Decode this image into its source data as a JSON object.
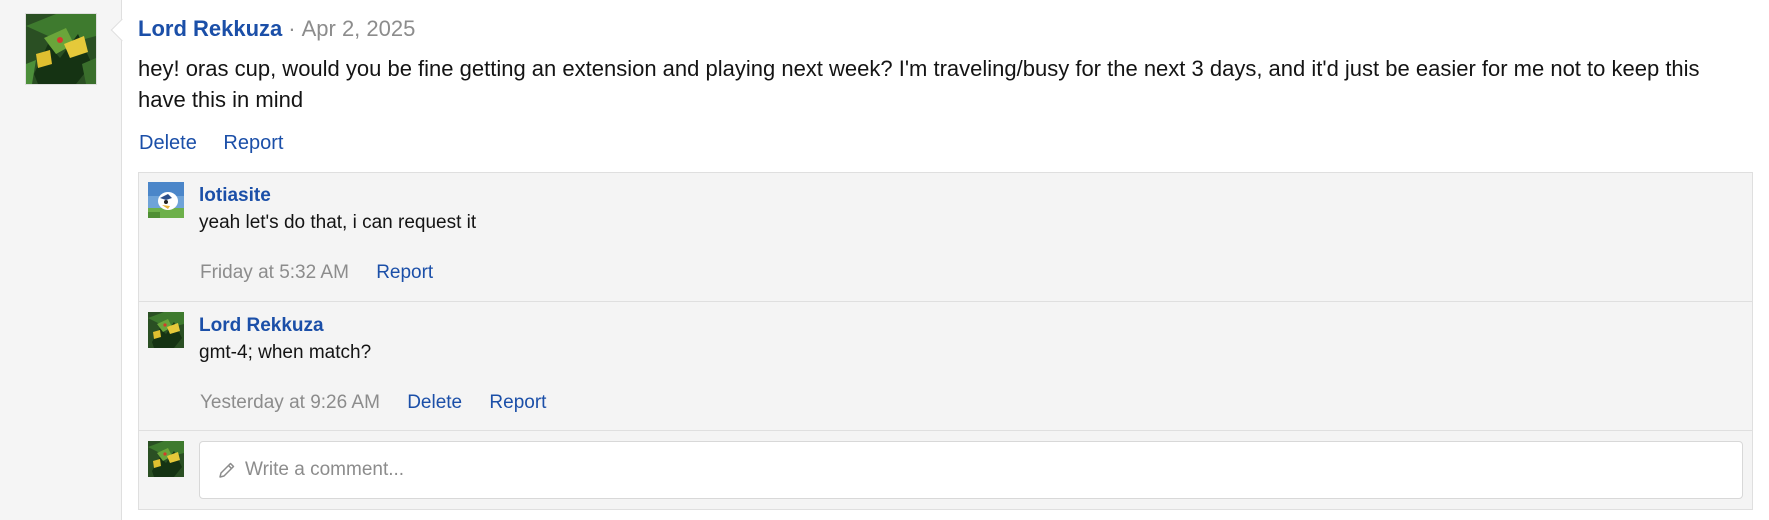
{
  "post": {
    "author": "Lord Rekkuza",
    "separator": "·",
    "date": "Apr 2, 2025",
    "body": "hey! oras cup, would you be fine getting an extension and playing next week? I'm traveling/busy for the next 3 days, and it'd just be easier for me not to keep this have this in mind",
    "actions": {
      "delete": "Delete",
      "report": "Report"
    }
  },
  "comments": [
    {
      "author": "lotiasite",
      "text": "yeah let's do that, i can request it",
      "time": "Friday at 5:32 AM",
      "report": "Report",
      "avatar_icon": "lotiasite-avatar"
    },
    {
      "author": "Lord Rekkuza",
      "text": "gmt-4; when match?",
      "time": "Yesterday at 9:26 AM",
      "delete": "Delete",
      "report": "Report",
      "avatar_icon": "rayquaza-avatar"
    }
  ],
  "reply": {
    "placeholder": "Write a comment...",
    "icon": "pencil-icon"
  },
  "colors": {
    "link": "#1b4fa8",
    "muted": "#8c8c8c",
    "comment_bg": "#f4f4f4",
    "gutter_bg": "#f5f5f5",
    "border": "#dfdfdf"
  }
}
